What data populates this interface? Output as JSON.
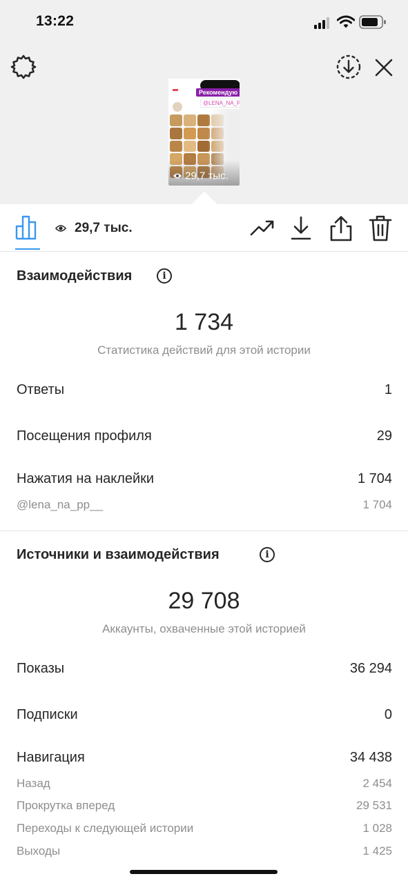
{
  "status_bar": {
    "time": "13:22"
  },
  "story_preview": {
    "sticker_text": "Рекомендую",
    "mention_text": "@LENA_NA_PP_",
    "views": "29,7 тыс."
  },
  "toolbar": {
    "views": "29,7 тыс."
  },
  "interactions": {
    "title": "Взаимодействия",
    "total": "1 734",
    "caption": "Статистика действий для этой истории",
    "rows": [
      {
        "label": "Ответы",
        "value": "1"
      },
      {
        "label": "Посещения профиля",
        "value": "29"
      },
      {
        "label": "Нажатия на наклейки",
        "value": "1 704"
      }
    ],
    "sticker_rows": [
      {
        "label": "@lena_na_pp__",
        "value": "1 704"
      }
    ]
  },
  "discovery": {
    "title": "Источники и взаимодействия",
    "total": "29 708",
    "caption": "Аккаунты, охваченные этой историей",
    "rows": [
      {
        "label": "Показы",
        "value": "36 294"
      },
      {
        "label": "Подписки",
        "value": "0"
      },
      {
        "label": "Навигация",
        "value": "34 438"
      }
    ],
    "navigation_rows": [
      {
        "label": "Назад",
        "value": "2 454"
      },
      {
        "label": "Прокрутка вперед",
        "value": "29 531"
      },
      {
        "label": "Переходы к следующей истории",
        "value": "1 028"
      },
      {
        "label": "Выходы",
        "value": "1 425"
      }
    ]
  },
  "icons": [
    "settings-icon",
    "save-story-icon",
    "close-icon",
    "insights-tab-icon",
    "eye-icon",
    "promote-icon",
    "download-icon",
    "share-icon",
    "delete-icon",
    "signal-icon",
    "wifi-icon",
    "battery-icon"
  ],
  "colors": {
    "accent": "#3897f0",
    "text": "#262626",
    "secondary_text": "#8e8e8e",
    "sticker": "#8a1fa8"
  }
}
